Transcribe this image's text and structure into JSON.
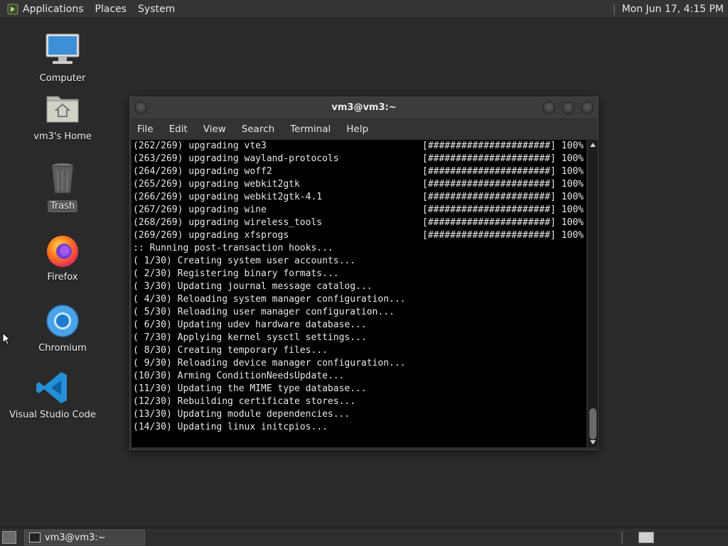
{
  "top_panel": {
    "menus": [
      "Applications",
      "Places",
      "System"
    ],
    "clock": "Mon Jun 17,  4:15 PM"
  },
  "desktop": {
    "icons": [
      {
        "label": "Computer",
        "icon": "computer-icon"
      },
      {
        "label": "vm3's Home",
        "icon": "home-folder-icon"
      },
      {
        "label": "Trash",
        "icon": "trash-icon"
      },
      {
        "label": "Firefox",
        "icon": "firefox-icon"
      },
      {
        "label": "Chromium",
        "icon": "chromium-icon"
      },
      {
        "label": "Visual Studio Code",
        "icon": "vscode-icon"
      }
    ]
  },
  "terminal": {
    "title": "vm3@vm3:~",
    "menu": [
      "File",
      "Edit",
      "View",
      "Search",
      "Terminal",
      "Help"
    ],
    "lines": [
      {
        "text": "(262/269) upgrading vte3",
        "bar": "[######################] 100%"
      },
      {
        "text": "(263/269) upgrading wayland-protocols",
        "bar": "[######################] 100%"
      },
      {
        "text": "(264/269) upgrading woff2",
        "bar": "[######################] 100%"
      },
      {
        "text": "(265/269) upgrading webkit2gtk",
        "bar": "[######################] 100%"
      },
      {
        "text": "(266/269) upgrading webkit2gtk-4.1",
        "bar": "[######################] 100%"
      },
      {
        "text": "(267/269) upgrading wine",
        "bar": "[######################] 100%"
      },
      {
        "text": "(268/269) upgrading wireless_tools",
        "bar": "[######################] 100%"
      },
      {
        "text": "(269/269) upgrading xfsprogs",
        "bar": "[######################] 100%"
      },
      {
        "text": ":: Running post-transaction hooks...",
        "bar": ""
      },
      {
        "text": "( 1/30) Creating system user accounts...",
        "bar": ""
      },
      {
        "text": "( 2/30) Registering binary formats...",
        "bar": ""
      },
      {
        "text": "( 3/30) Updating journal message catalog...",
        "bar": ""
      },
      {
        "text": "( 4/30) Reloading system manager configuration...",
        "bar": ""
      },
      {
        "text": "( 5/30) Reloading user manager configuration...",
        "bar": ""
      },
      {
        "text": "( 6/30) Updating udev hardware database...",
        "bar": ""
      },
      {
        "text": "( 7/30) Applying kernel sysctl settings...",
        "bar": ""
      },
      {
        "text": "( 8/30) Creating temporary files...",
        "bar": ""
      },
      {
        "text": "( 9/30) Reloading device manager configuration...",
        "bar": ""
      },
      {
        "text": "(10/30) Arming ConditionNeedsUpdate...",
        "bar": ""
      },
      {
        "text": "(11/30) Updating the MIME type database...",
        "bar": ""
      },
      {
        "text": "(12/30) Rebuilding certificate stores...",
        "bar": ""
      },
      {
        "text": "(13/30) Updating module dependencies...",
        "bar": ""
      },
      {
        "text": "(14/30) Updating linux initcpios...",
        "bar": ""
      }
    ]
  },
  "taskbar": {
    "window_button": "vm3@vm3:~"
  },
  "colors": {
    "desktop_bg": "#2a2a2a",
    "terminal_bg": "#000000",
    "terminal_fg": "#e8e8e8"
  }
}
